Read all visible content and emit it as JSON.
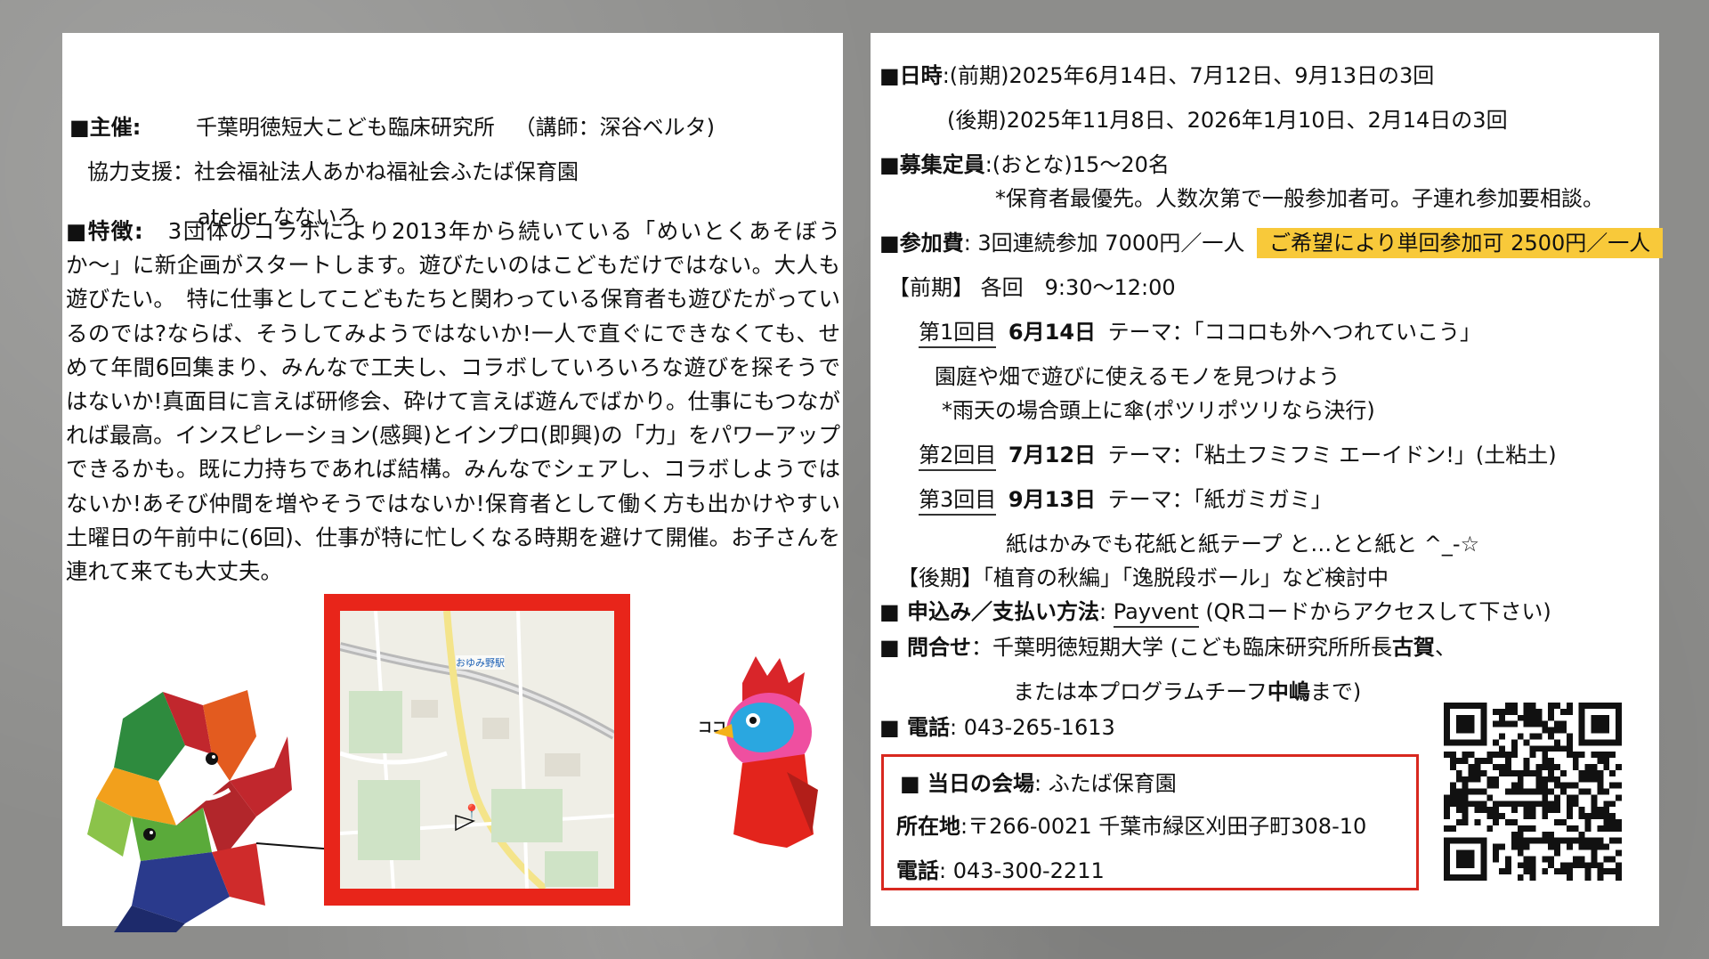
{
  "left": {
    "organizer_label": "■主催",
    "organizer_colon": ":",
    "organizer_value": "千葉明徳短大こども臨床研究所",
    "lecturer": "（講師：深谷ベルタ)",
    "support_label": "協力支援：",
    "support_value": "社会福祉法人あかね福祉会ふたば保育園",
    "atelier": "atelier なないろ",
    "feature_label": "■特徴:",
    "feature_text": "3団体のコラボにより2013年から続いている「めいとくあそぼうか〜」に新企画がスタートします。遊びたいのはこどもだけではない。大人も遊びたい。　特に仕事としてこどもたちと関わっている保育者も遊びたがっているのでは?ならば、そうしてみようではないか!一人で直ぐにできなくても、せめて年間6回集まり、みんなで工夫し、コラボしていろいろな遊びを探そうではないか!真面目に言えば研修会、砕けて言えば遊んでばかり。仕事にもつながれば最高。インスピレーション(感興)とインプロ(即興)の「力」をパワーアップできるかも。既に力持ちであれば結構。みんなでシェアし、コラボしようではないか!あそび仲間を増やそうではないか!保育者として働く方も出かけやすい土曜日の午前中に(6回)、仕事が特に忙しくなる時期を避けて開催。お子さんを連れて来ても大丈夫。",
    "map_station": "おゆみ野駅",
    "kokodako": "ココダココ"
  },
  "right": {
    "date_label": "■日時",
    "date_first": ":(前期)2025年6月14日、7月12日、9月13日の3回",
    "date_second": "(後期)2025年11月8日、2026年1月10日、2月14日の3回",
    "capacity_label": "■募集定員",
    "capacity_value": ":(おとな)15～20名",
    "capacity_note": "*保育者最優先。人数次第で一般参加者可。子連れ参加要相談。",
    "fee_label": "■参加費",
    "fee_value": ": 3回連続参加 7000円／一人",
    "fee_highlight": "ご希望により単回参加可 2500円／一人",
    "first_term": "【前期】 各回　9:30～12:00",
    "session1_num": "第1回目",
    "session1_date": "6月14日",
    "session1_theme": "テーマ：「ココロも外へつれていこう」",
    "session1_desc": "園庭や畑で遊びに使えるモノを見つけよう",
    "session1_note": "*雨天の場合頭上に傘(ポツリポツリなら決行)",
    "session2_num": "第2回目",
    "session2_date": "7月12日",
    "session2_theme": "テーマ：「粘土フミフミ エーイドン!」(土粘土)",
    "session3_num": "第3回目",
    "session3_date": "9月13日",
    "session3_theme": "テーマ：「紙ガミガミ」",
    "session3_desc": "紙はかみでも花紙と紙テープ と…とと紙と ^_-☆",
    "second_term": "【後期】「植育の秋編」「逸脱段ボール」など検討中",
    "apply_label": "■ 申込み／支払い方法",
    "apply_colon": ":",
    "apply_link": "Payvent",
    "apply_note": "(QRコードからアクセスして下さい)",
    "contact_label": "■ 問合せ",
    "contact_value_1": "：千葉明徳短期大学 (こども臨床研究所所長",
    "contact_name_1": "古賀",
    "contact_value_1b": "、",
    "contact_value_2": "または本プログラムチーフ",
    "contact_name_2": "中嶋",
    "contact_value_2b": "まで)",
    "phone_label": "■ 電話",
    "phone_value": ": 043-265-1613",
    "venue_label": "■ 当日の会場",
    "venue_value": ": ふたば保育園",
    "address_label": "所在地",
    "address_value": ":〒266-0021 千葉市緑区刈田子町308-10",
    "venue_phone_label": "電話",
    "venue_phone_value": ": 043-300-2211"
  },
  "colors": {
    "highlight": "#f8c93a",
    "frame_red": "#e8251a",
    "box_red": "#d8281f"
  }
}
